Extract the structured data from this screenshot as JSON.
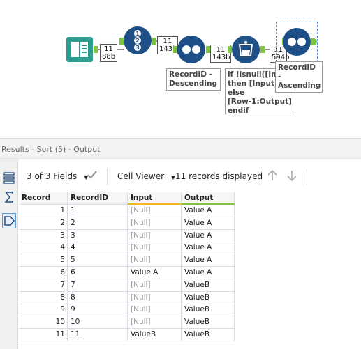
{
  "workflow": {
    "badges": [
      {
        "records": "11",
        "size": "88b"
      },
      {
        "records": "11",
        "size": "143b"
      },
      {
        "records": "11",
        "size": "143b"
      },
      {
        "records": "11",
        "size": "594b"
      }
    ],
    "annotations": {
      "sort_desc": "RecordID -\nDescending",
      "formula": "if !isnull([Input\nthen [Input] else\n[Row-1:Output]\nendif",
      "sort_asc": "RecordID -\nAscending"
    },
    "accent_colors": {
      "tool_blue": "#1e4f87",
      "input_teal": "#2a9d8f",
      "anchor_green": "#7dc242"
    }
  },
  "results": {
    "header": "Results - Sort (5) - Output",
    "fields_label": "3 of 3 Fields",
    "viewer_label": "Cell Viewer",
    "records_label": "11 records displayed",
    "columns": [
      "Record",
      "RecordID",
      "Input",
      "Output"
    ],
    "rows": [
      [
        "1",
        "1",
        "[Null]",
        "Value A"
      ],
      [
        "2",
        "2",
        "[Null]",
        "Value A"
      ],
      [
        "3",
        "3",
        "[Null]",
        "Value A"
      ],
      [
        "4",
        "4",
        "[Null]",
        "Value A"
      ],
      [
        "5",
        "5",
        "[Null]",
        "Value A"
      ],
      [
        "6",
        "6",
        "Value A",
        "Value A"
      ],
      [
        "7",
        "7",
        "[Null]",
        "ValueB"
      ],
      [
        "8",
        "8",
        "[Null]",
        "ValueB"
      ],
      [
        "9",
        "9",
        "[Null]",
        "ValueB"
      ],
      [
        "10",
        "10",
        "[Null]",
        "ValueB"
      ],
      [
        "11",
        "11",
        "ValueB",
        "ValueB"
      ]
    ]
  }
}
